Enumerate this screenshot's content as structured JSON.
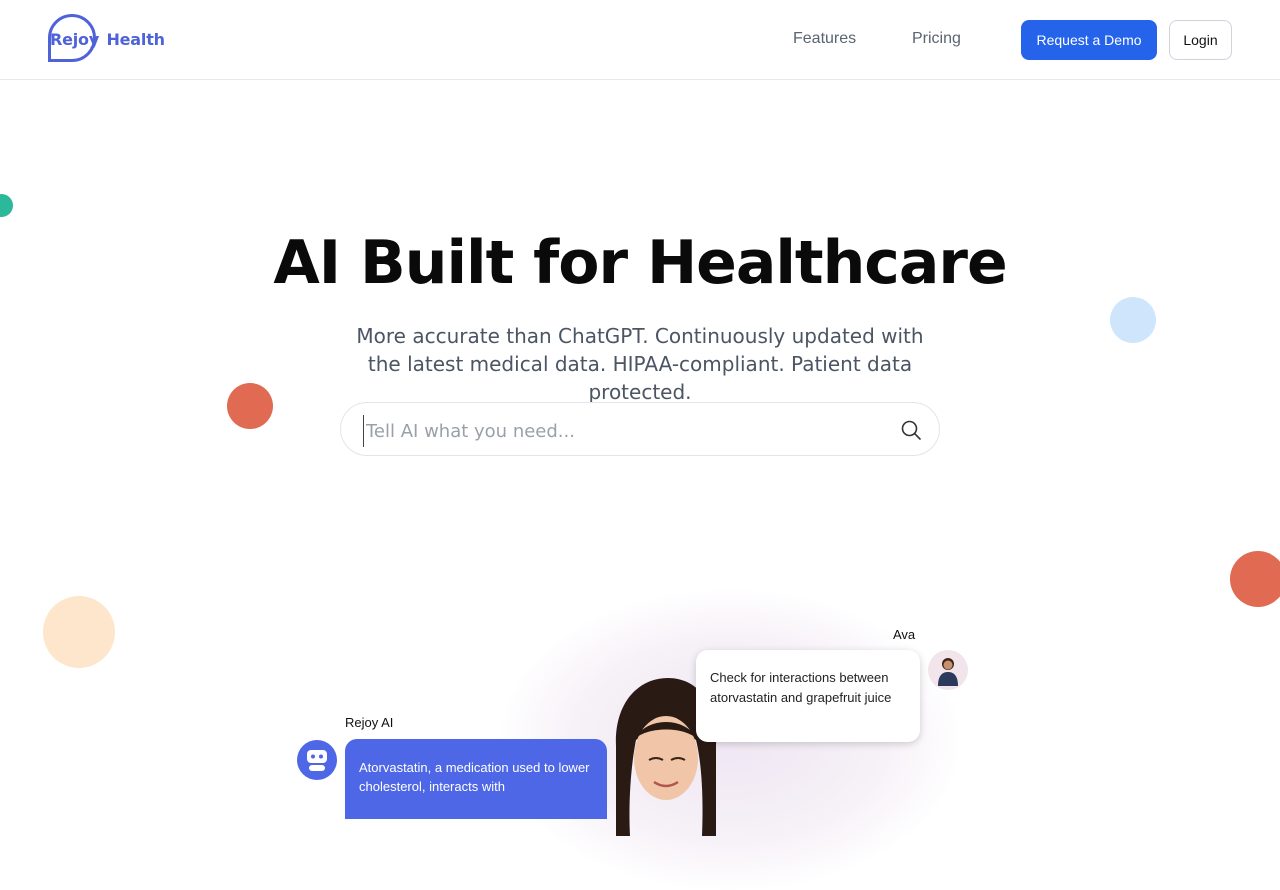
{
  "header": {
    "logo": {
      "word1": "Rejoy",
      "word2": "Health",
      "color": "#4f63d8"
    },
    "nav": [
      {
        "label": "Features"
      },
      {
        "label": "Pricing"
      }
    ],
    "cta_label": "Request a Demo",
    "login_label": "Login",
    "accent": "#2563eb"
  },
  "hero": {
    "title": "AI Built for Healthcare",
    "subtitle": "More accurate than ChatGPT. Continuously updated with the latest medical data. HIPAA-compliant. Patient data protected.",
    "search": {
      "placeholder": "Tell AI what you need...",
      "value": "",
      "icon": "search-icon"
    }
  },
  "chat": {
    "user_name": "Ava",
    "user_message": "Check for interactions between atorvastatin and grapefruit juice",
    "ai_name": "Rejoy AI",
    "ai_message": "Atorvastatin, a medication used to lower cholesterol, interacts with",
    "ai_color": "#4d67e6"
  },
  "decor_colors": {
    "teal": "#2cb89a",
    "coral": "#e06a52",
    "light_blue": "#cfe5fb",
    "peach": "#fde6cc"
  }
}
